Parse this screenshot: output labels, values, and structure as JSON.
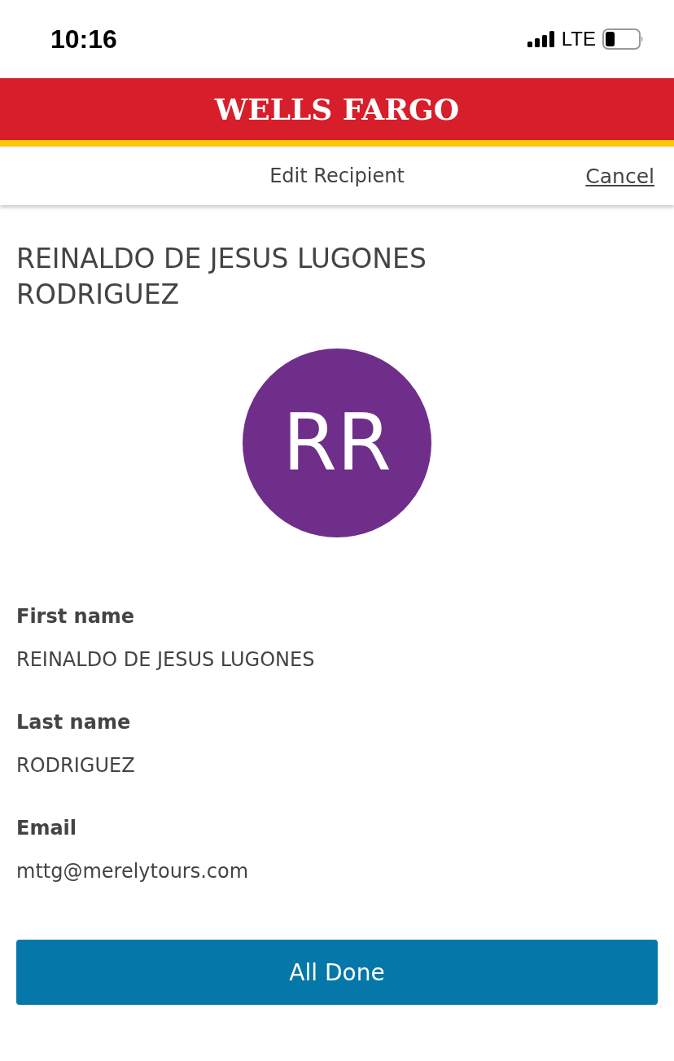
{
  "status_bar": {
    "time": "10:16",
    "network": "LTE"
  },
  "brand": {
    "logo": "WELLS FARGO"
  },
  "nav": {
    "title": "Edit Recipient",
    "cancel": "Cancel"
  },
  "recipient": {
    "full_name": "REINALDO DE JESUS LUGONES RODRIGUEZ",
    "initials": "RR"
  },
  "fields": [
    {
      "label": "First name",
      "value": "REINALDO DE JESUS LUGONES"
    },
    {
      "label": "Last name",
      "value": "RODRIGUEZ"
    },
    {
      "label": "Email",
      "value": "mttg@merelytours.com"
    }
  ],
  "primary_button": "All Done"
}
